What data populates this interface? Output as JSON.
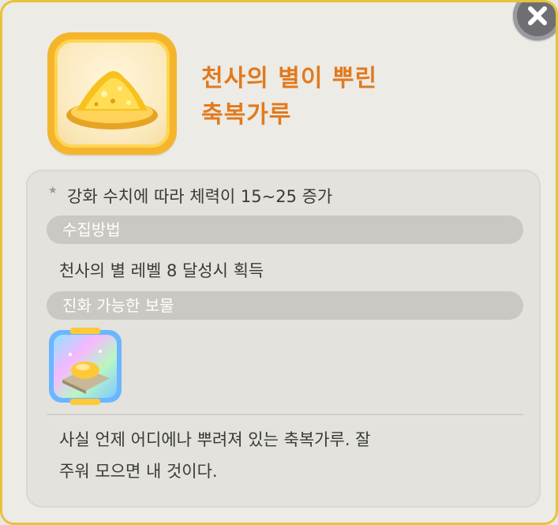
{
  "item": {
    "name_line1": "천사의 별이 뿌린",
    "name_line2": "축복가루",
    "icon": "golden-powder-icon"
  },
  "close": {
    "icon": "close-icon"
  },
  "description": "강화 수치에 따라 체력이 15~25 증가",
  "sections": {
    "acquire_label": "수집방법",
    "acquire_text": "천사의 별 레벨 8 달성시 획득",
    "evolve_label": "진화 가능한 보물",
    "evolve_item_icon": "golden-butter-treasure-icon"
  },
  "flavor_line1": "사실 언제 어디에나 뿌려져 있는 축복가루. 잘",
  "flavor_line2": "주워 모으면 내 것이다.",
  "colors": {
    "title": "#e17a1e",
    "frame": "#e7c23a",
    "icon_box": "#f4b52c",
    "section_bar": "#c9c8c3"
  }
}
